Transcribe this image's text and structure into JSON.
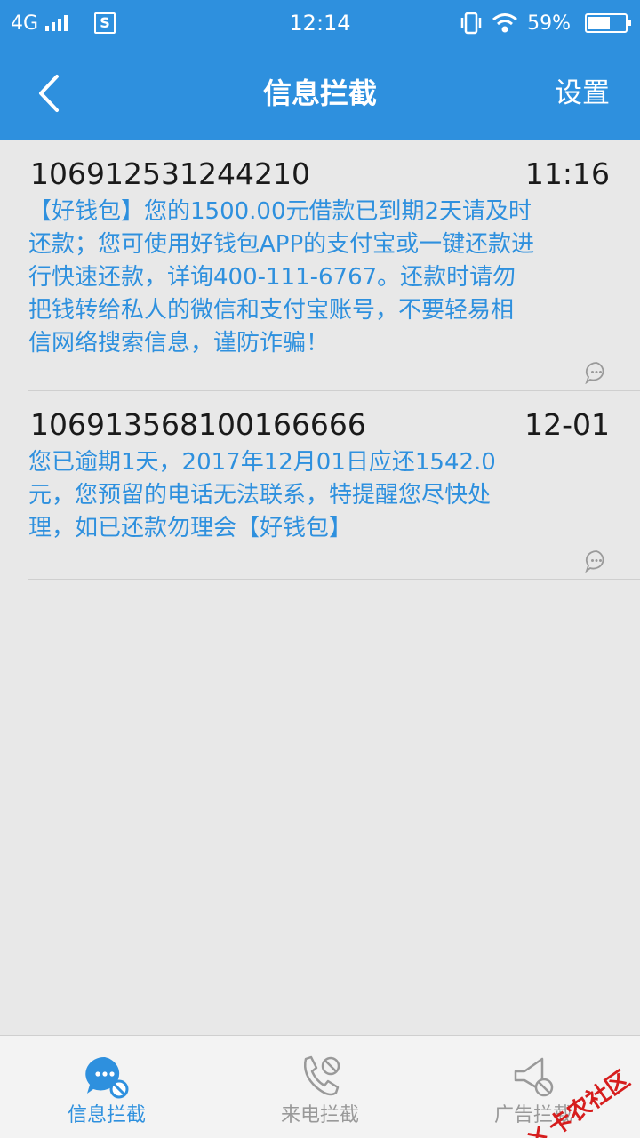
{
  "status_bar": {
    "network": "4G",
    "sim_label": "S",
    "time": "12:14",
    "battery_percent": "59%",
    "battery_level": 0.59
  },
  "header": {
    "title": "信息拦截",
    "settings_label": "设置"
  },
  "messages": [
    {
      "sender": "106912531244210",
      "time": "11:16",
      "body": "【好钱包】您的1500.00元借款已到期2天请及时还款；您可使用好钱包APP的支付宝或一键还款进行快速还款，详询400-111-6767。还款时请勿把钱转给私人的微信和支付宝账号，不要轻易相信网络搜索信息，谨防诈骗！"
    },
    {
      "sender": "106913568100166666",
      "time": "12-01",
      "body": "您已逾期1天，2017年12月01日应还1542.0元，您预留的电话无法联系，特提醒您尽快处理，如已还款勿理会【好钱包】"
    }
  ],
  "tabs": [
    {
      "label": "信息拦截",
      "icon": "message-block-icon",
      "active": true
    },
    {
      "label": "来电拦截",
      "icon": "call-block-icon",
      "active": false
    },
    {
      "label": "广告拦截",
      "icon": "ad-block-icon",
      "active": false
    }
  ],
  "watermark": {
    "text": "卡农社区"
  },
  "colors": {
    "primary": "#2e90de",
    "background": "#e8e8e8",
    "tab_inactive": "#999999"
  }
}
